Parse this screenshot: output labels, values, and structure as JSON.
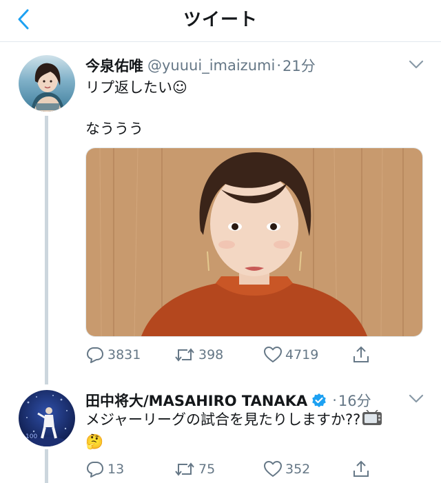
{
  "header": {
    "title": "ツイート"
  },
  "tweets": [
    {
      "name": "今泉佑唯",
      "handle": "@yuuui_imaizumi",
      "dot": "·",
      "time": "21分",
      "text_line1": "リプ返したい☺",
      "text_line2": "なううう",
      "reply_count": "3831",
      "retweet_count": "398",
      "like_count": "4719"
    },
    {
      "name": "田中将大/MASAHIRO TANAKA",
      "dot": "·",
      "time": "16分",
      "text_line1": "メジャーリーグの試合を見たりしますか??",
      "text_emoji": "🤔",
      "reply_count": "13",
      "retweet_count": "75",
      "like_count": "352"
    }
  ],
  "colors": {
    "accent": "#1da1f2",
    "secondary_text": "#657786",
    "divider": "#e1e8ed"
  }
}
